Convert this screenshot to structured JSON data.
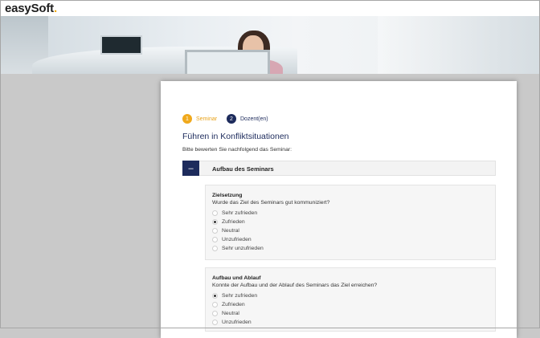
{
  "header": {
    "logo_text": "easySoft",
    "logo_dot": "."
  },
  "stepper": {
    "steps": [
      {
        "number": "1",
        "label": "Seminar",
        "active": true
      },
      {
        "number": "2",
        "label": "Dozent(en)",
        "active": false
      }
    ]
  },
  "page": {
    "title": "Führen in Konfliktsituationen",
    "instruction": "Bitte bewerten Sie nachfolgend das Seminar:"
  },
  "section": {
    "toggle_symbol": "–",
    "title": "Aufbau des Seminars"
  },
  "questions": [
    {
      "title": "Zielsetzung",
      "text": "Wurde das Ziel des Seminars gut kommuniziert?",
      "options": [
        "Sehr zufrieden",
        "Zufrieden",
        "Neutral",
        "Unzufrieden",
        "Sehr unzufrieden"
      ],
      "selected": "Zufrieden"
    },
    {
      "title": "Aufbau und Ablauf",
      "text": "Konnte der Aufbau und der Ablauf des Seminars das Ziel erreichen?",
      "options": [
        "Sehr zufrieden",
        "Zufrieden",
        "Neutral",
        "Unzufrieden"
      ],
      "selected": "Sehr zufrieden"
    }
  ],
  "colors": {
    "brand_navy": "#1d2b5c",
    "accent_orange": "#f0a91c"
  }
}
